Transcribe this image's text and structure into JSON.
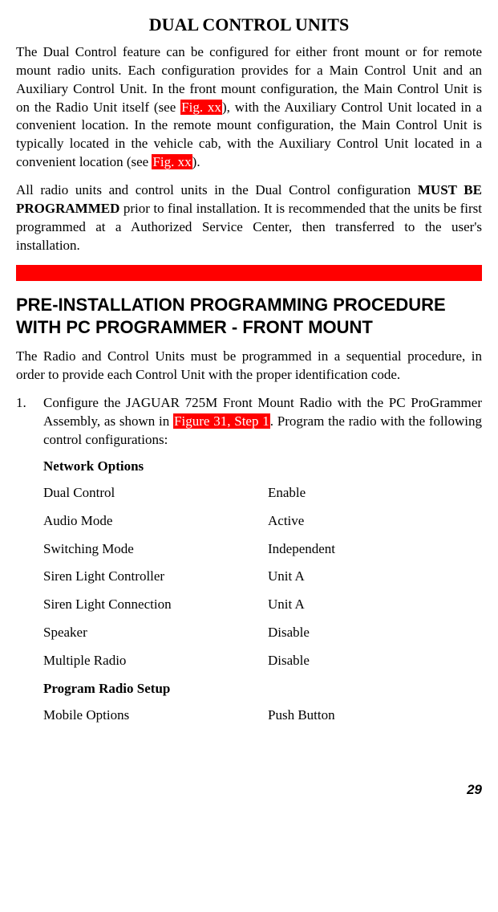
{
  "title": "DUAL CONTROL UNITS",
  "para1_a": "The Dual Control feature can be configured for either front mount or for remote mount radio units. Each configuration provides for a Main Control Unit and an Auxiliary Control Unit. In the front mount configuration, the Main Control Unit is on the Radio Unit itself (see ",
  "figxx1": "Fig. xx",
  "para1_b": "), with the Auxiliary Control Unit located in a convenient location. In the remote mount configuration, the Main Control Unit is typically located in the vehicle cab, with the Auxiliary Control Unit located in a convenient location (see ",
  "figxx2": "Fig. xx",
  "para1_c": ").",
  "para2_a": "All radio units and control units in the Dual Control configuration ",
  "para2_bold": "MUST BE PROGRAMMED",
  "para2_b": " prior to final installation.  It is recommended that the units be first programmed at a Authorized Service Center, then transferred to the user's installation.",
  "heading2": "PRE-INSTALLATION PROGRAMMING PROCEDURE WITH PC PROGRAMMER - FRONT MOUNT",
  "para3": "The Radio and Control Units must be programmed in a sequential procedure, in order to provide each Control Unit with the proper identification code.",
  "step1_num": "1.",
  "step1_a": "Configure the J",
  "step1_sc": "AGUAR",
  "step1_b": " 725M Front Mount Radio with the PC ProGrammer Assembly, as shown in ",
  "step1_hl": "Figure 31, Step 1",
  "step1_c": ". Program the radio with the following control configurations:",
  "network_options_heading": "Network Options",
  "program_radio_setup_heading": "Program Radio Setup",
  "kv": [
    {
      "k": "Dual Control",
      "v": "Enable"
    },
    {
      "k": "Audio Mode",
      "v": "Active"
    },
    {
      "k": "Switching Mode",
      "v": "Independent"
    },
    {
      "k": "Siren Light Controller",
      "v": "Unit A"
    },
    {
      "k": "Siren Light Connection",
      "v": "Unit A"
    },
    {
      "k": "Speaker",
      "v": "Disable"
    },
    {
      "k": "Multiple Radio",
      "v": "Disable"
    }
  ],
  "kv2": [
    {
      "k": "Mobile Options",
      "v": "Push Button"
    }
  ],
  "page_number": "29"
}
